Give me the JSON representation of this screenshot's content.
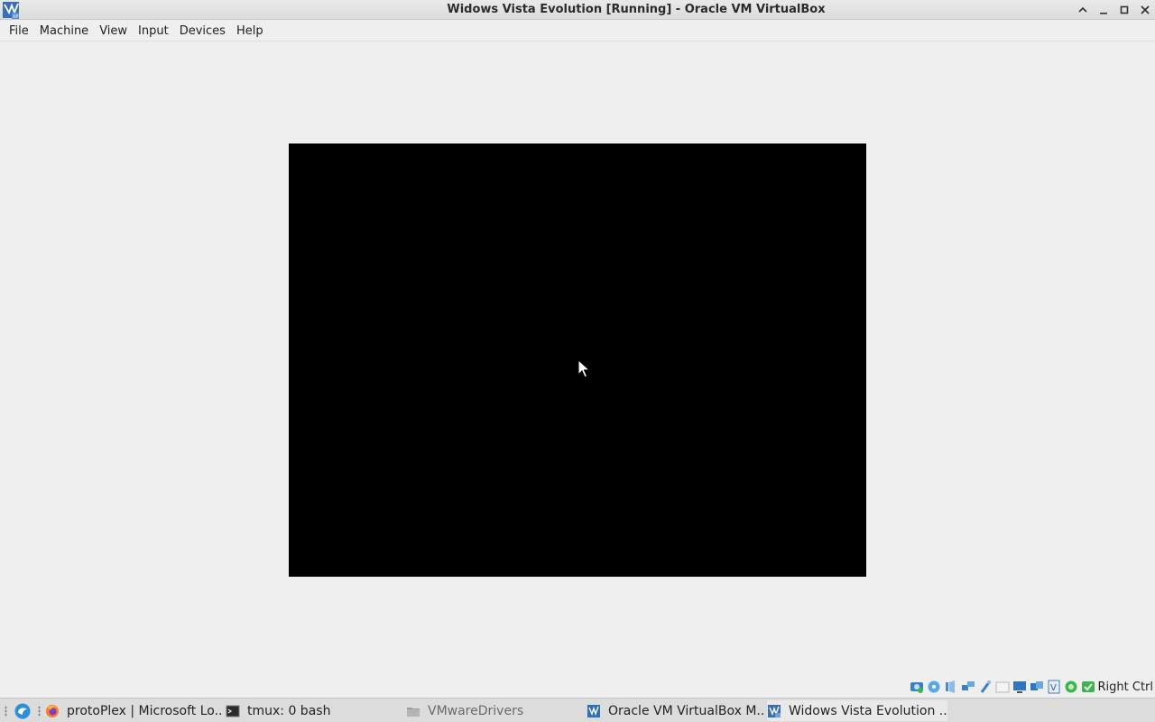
{
  "window": {
    "title": "Widows Vista Evolution [Running] - Oracle VM VirtualBox"
  },
  "menu": {
    "items": [
      "File",
      "Machine",
      "View",
      "Input",
      "Devices",
      "Help"
    ]
  },
  "statusbar": {
    "icons": [
      "hard-disk-icon",
      "optical-drive-icon",
      "audio-icon",
      "network-icon",
      "usb-icon",
      "shared-folders-icon",
      "display-icon",
      "video-capture-icon",
      "virtualization-icon",
      "mouse-integration-icon",
      "keyboard-icon"
    ],
    "host_key": "Right Ctrl"
  },
  "taskbar": {
    "tasks": [
      {
        "label": "protoPlex | Microsoft Lo...",
        "icon": "firefox-icon"
      },
      {
        "label": "tmux: 0 bash",
        "icon": "terminal-icon"
      },
      {
        "label": "VMwareDrivers",
        "icon": "folder-icon"
      },
      {
        "label": "Oracle VM VirtualBox M...",
        "icon": "virtualbox-manager-icon"
      },
      {
        "label": "Widows Vista Evolution ...",
        "icon": "virtualbox-vm-icon"
      }
    ]
  },
  "colors": {
    "vm_screen": "#000000",
    "chrome_bg": "#efefef",
    "taskbar_bg": "#dcdcdc"
  }
}
